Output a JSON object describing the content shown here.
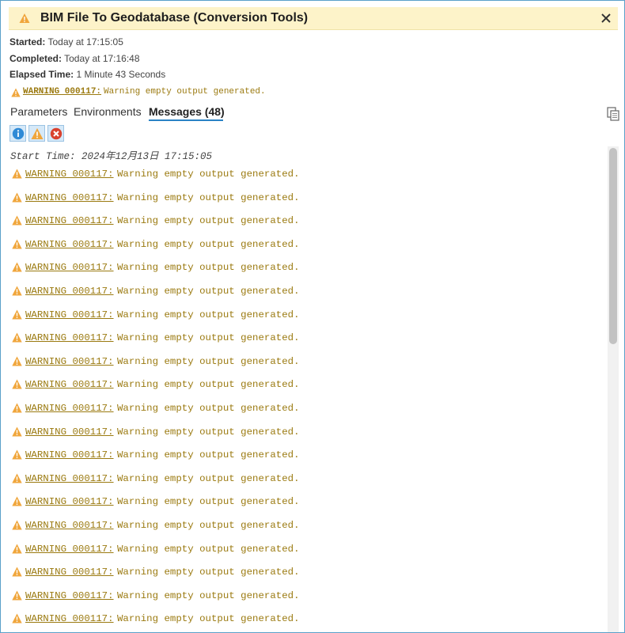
{
  "window": {
    "title": "BIM File To Geodatabase (Conversion Tools)",
    "icon": "warning-icon",
    "close_icon": "close-icon"
  },
  "meta": {
    "started_label": "Started:",
    "started_value": "Today at 17:15:05",
    "completed_label": "Completed:",
    "completed_value": "Today at 17:16:48",
    "elapsed_label": "Elapsed Time:",
    "elapsed_value": "1 Minute 43 Seconds"
  },
  "summary": {
    "code": "WARNING 000117:",
    "message": "Warning empty output generated."
  },
  "tabs": [
    {
      "label": "Parameters",
      "active": false
    },
    {
      "label": "Environments",
      "active": false
    },
    {
      "label": "Messages (48)",
      "active": true
    }
  ],
  "filters": [
    {
      "name": "info-filter-icon",
      "active": true
    },
    {
      "name": "warning-filter-icon",
      "active": true
    },
    {
      "name": "error-filter-icon",
      "active": true
    }
  ],
  "messages": {
    "start_time": "Start Time: 2024年12月13日 17:15:05",
    "items": [
      {
        "code": "WARNING 000117:",
        "text": "Warning empty output generated."
      },
      {
        "code": "WARNING 000117:",
        "text": "Warning empty output generated."
      },
      {
        "code": "WARNING 000117:",
        "text": "Warning empty output generated."
      },
      {
        "code": "WARNING 000117:",
        "text": "Warning empty output generated."
      },
      {
        "code": "WARNING 000117:",
        "text": "Warning empty output generated."
      },
      {
        "code": "WARNING 000117:",
        "text": "Warning empty output generated."
      },
      {
        "code": "WARNING 000117:",
        "text": "Warning empty output generated."
      },
      {
        "code": "WARNING 000117:",
        "text": "Warning empty output generated."
      },
      {
        "code": "WARNING 000117:",
        "text": "Warning empty output generated."
      },
      {
        "code": "WARNING 000117:",
        "text": "Warning empty output generated."
      },
      {
        "code": "WARNING 000117:",
        "text": "Warning empty output generated."
      },
      {
        "code": "WARNING 000117:",
        "text": "Warning empty output generated."
      },
      {
        "code": "WARNING 000117:",
        "text": "Warning empty output generated."
      },
      {
        "code": "WARNING 000117:",
        "text": "Warning empty output generated."
      },
      {
        "code": "WARNING 000117:",
        "text": "Warning empty output generated."
      },
      {
        "code": "WARNING 000117:",
        "text": "Warning empty output generated."
      },
      {
        "code": "WARNING 000117:",
        "text": "Warning empty output generated."
      },
      {
        "code": "WARNING 000117:",
        "text": "Warning empty output generated."
      },
      {
        "code": "WARNING 000117:",
        "text": "Warning empty output generated."
      },
      {
        "code": "WARNING 000117:",
        "text": "Warning empty output generated."
      }
    ]
  },
  "colors": {
    "title_bar_bg": "#fdf3c9",
    "warning_text": "#9b7a10",
    "warning_icon": "#f0a63c",
    "tab_underline": "#2a83c5",
    "frame_border": "#5aa0c9"
  }
}
